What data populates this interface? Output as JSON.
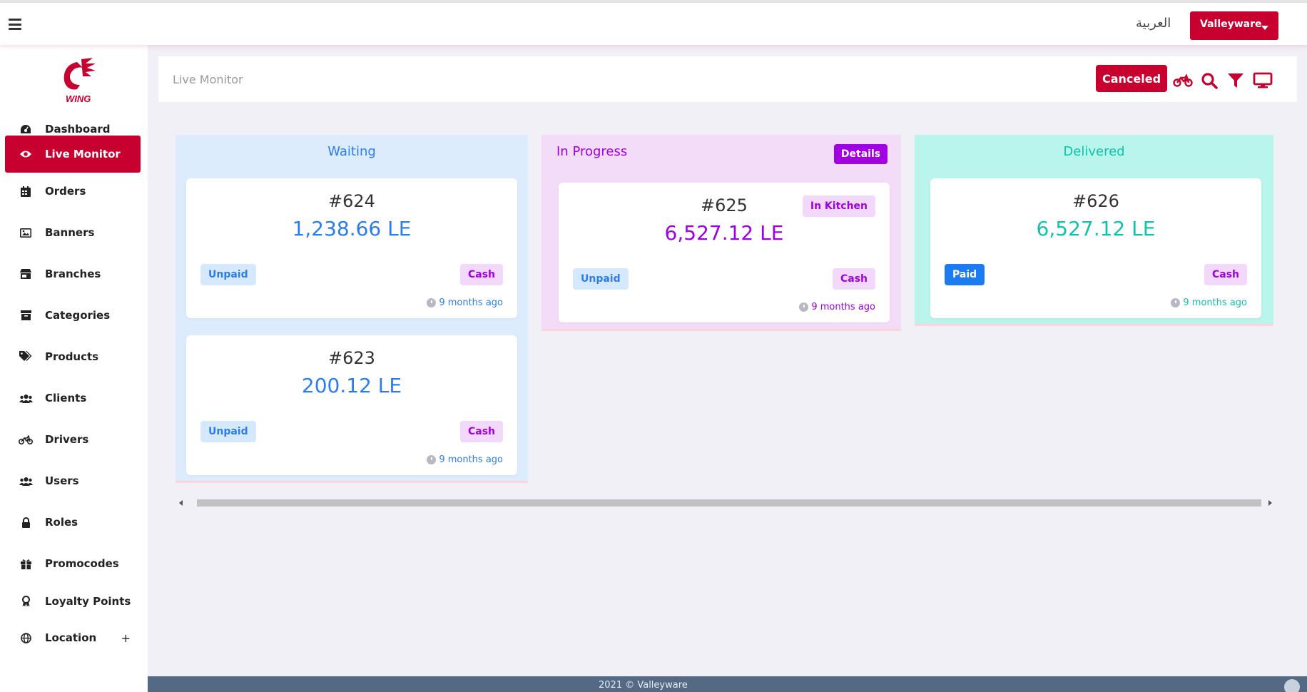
{
  "topbar": {
    "menu_icon": "hamburger-icon",
    "language_label": "العربية",
    "user_button_label": "Valleyware"
  },
  "sidebar": {
    "logo_text": "WING",
    "items": [
      {
        "label": "Dashboard",
        "icon": "gauge-icon"
      },
      {
        "label": "Live Monitor",
        "icon": "eye-icon",
        "active": true
      },
      {
        "label": "Orders",
        "icon": "calendar-icon"
      },
      {
        "label": "Banners",
        "icon": "image-icon"
      },
      {
        "label": "Branches",
        "icon": "store-icon"
      },
      {
        "label": "Categories",
        "icon": "archive-icon"
      },
      {
        "label": "Products",
        "icon": "tags-icon"
      },
      {
        "label": "Clients",
        "icon": "users-icon"
      },
      {
        "label": "Drivers",
        "icon": "motorcycle-icon"
      },
      {
        "label": "Users",
        "icon": "users-icon"
      },
      {
        "label": "Roles",
        "icon": "lock-icon"
      },
      {
        "label": "Promocodes",
        "icon": "gift-icon"
      },
      {
        "label": "Loyalty Points",
        "icon": "award-icon"
      },
      {
        "label": "Location",
        "icon": "globe-icon",
        "expand": "+"
      }
    ]
  },
  "header": {
    "title": "Live Monitor",
    "canceled_label": "Canceled",
    "icons": [
      "motorcycle-icon",
      "search-icon",
      "filter-icon",
      "desktop-icon"
    ]
  },
  "columns": {
    "waiting": {
      "title": "Waiting",
      "color": "#2b7de9",
      "cards": [
        {
          "number": "#624",
          "amount": "1,238.66 LE",
          "payment_status": "Unpaid",
          "method": "Cash",
          "time": "9 months ago"
        },
        {
          "number": "#623",
          "amount": "200.12 LE",
          "payment_status": "Unpaid",
          "method": "Cash",
          "time": "9 months ago"
        }
      ]
    },
    "in_progress": {
      "title": "In Progress",
      "color": "#a100e0",
      "details_label": "Details",
      "cards": [
        {
          "number": "#625",
          "amount": "6,527.12 LE",
          "stage": "In Kitchen",
          "payment_status": "Unpaid",
          "method": "Cash",
          "time": "9 months ago"
        }
      ]
    },
    "delivered": {
      "title": "Delivered",
      "color": "#11c2aa",
      "cards": [
        {
          "number": "#626",
          "amount": "6,527.12 LE",
          "payment_status": "Paid",
          "method": "Cash",
          "time": "9 months ago"
        }
      ]
    }
  },
  "footer": {
    "copyright": "2021 © Valleyware"
  }
}
